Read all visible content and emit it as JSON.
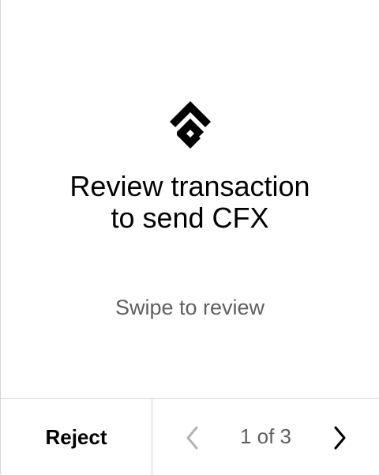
{
  "brand": {
    "logo_icon": "conflux-logo-icon"
  },
  "review": {
    "title_line1": "Review transaction",
    "title_line2": "to send CFX",
    "subtitle": "Swipe to review"
  },
  "footer": {
    "reject_label": "Reject",
    "page_indicator": "1 of 3",
    "prev_icon": "chevron-left-icon",
    "next_icon": "chevron-right-icon"
  },
  "colors": {
    "text_primary": "#000000",
    "text_secondary": "#5f5f5f",
    "divider": "#d4d4d4",
    "disabled_icon": "#b3b3b3"
  }
}
